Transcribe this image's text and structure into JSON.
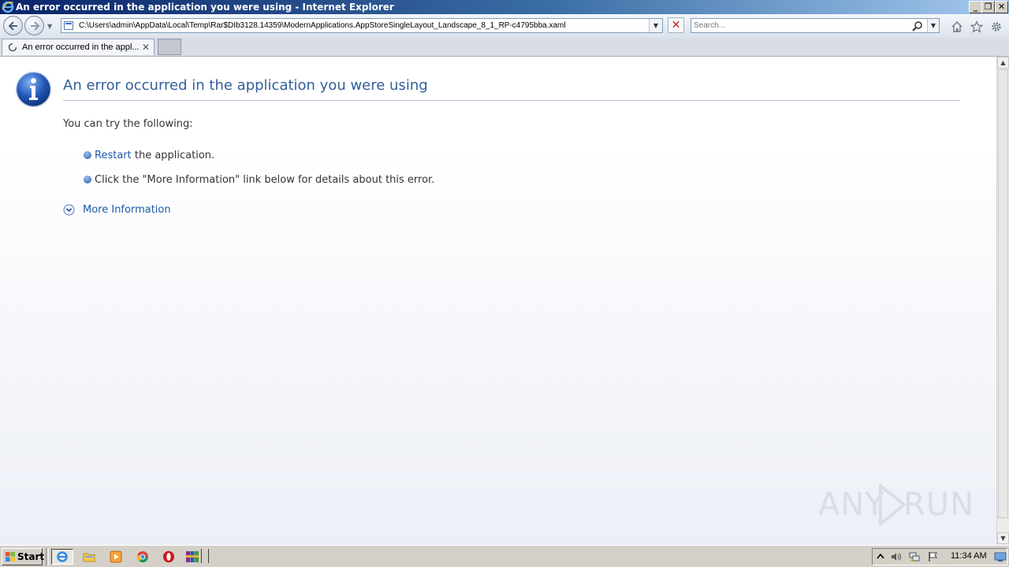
{
  "window": {
    "title": "An error occurred in the application you were using - Internet Explorer",
    "minimize_glyph": "_",
    "restore_glyph": "❐",
    "close_glyph": "✕"
  },
  "navbar": {
    "address_url": "C:\\Users\\admin\\AppData\\Local\\Temp\\Rar$DIb3128.14359\\ModernApplications.AppStoreSingleLayout_Landscape_8_1_RP-c4795bba.xaml",
    "dropdown_glyph": "▼",
    "stop_glyph": "✕",
    "search_placeholder": "Search..."
  },
  "tabs": [
    {
      "label": "An error occurred in the appl...",
      "close_glyph": "✕"
    }
  ],
  "page": {
    "heading": "An error occurred in the application you were using",
    "intro": "You can try the following:",
    "bullets": {
      "restart_link": "Restart",
      "restart_rest": " the application.",
      "more_info_hint": "Click the \"More Information\" link below for details about this error."
    },
    "more_info_label": "More Information"
  },
  "watermark": {
    "left": "ANY",
    "right": "RUN"
  },
  "scrollbar": {
    "up_glyph": "▲",
    "down_glyph": "▼"
  },
  "taskbar": {
    "start_label": "Start",
    "clock": "11:34 AM"
  },
  "colors": {
    "heading": "#335e9a",
    "link": "#1e5aa8",
    "titlebar_start": "#0a246a",
    "taskbar": "#d4d0c8"
  }
}
